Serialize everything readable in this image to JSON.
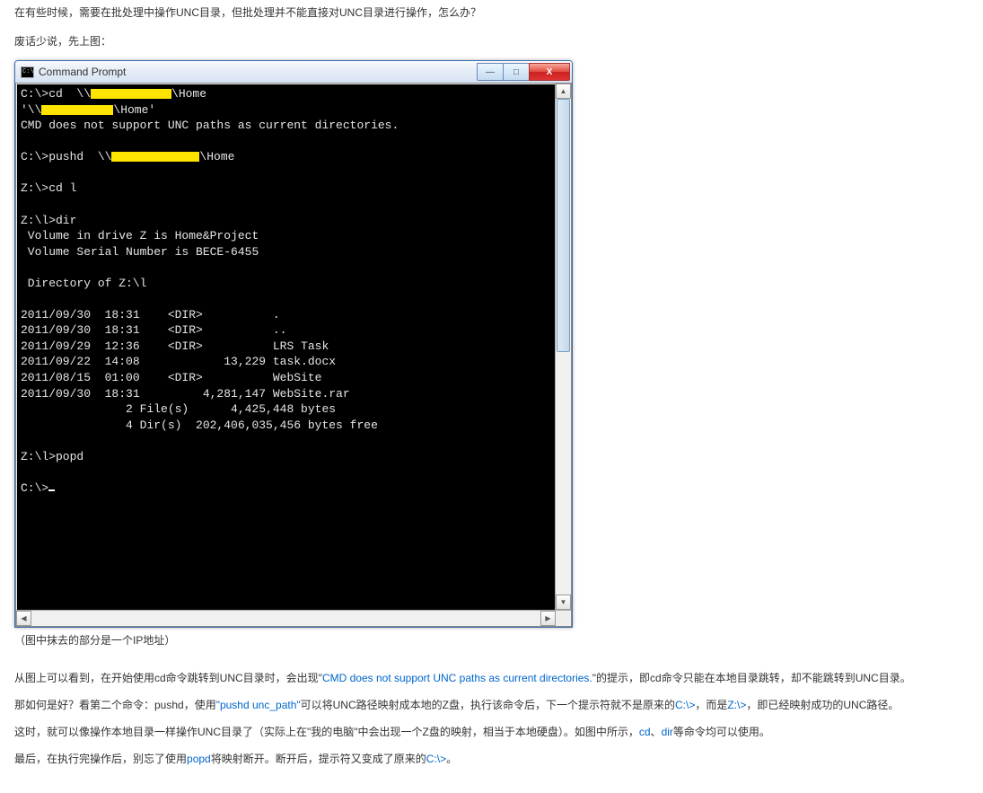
{
  "intro": {
    "p1": "在有些时候，需要在批处理中操作UNC目录，但批处理并不能直接对UNC目录进行操作，怎么办？",
    "p2": "废话少说，先上图："
  },
  "window": {
    "title": "Command Prompt",
    "icon_text": "C:\\",
    "buttons": {
      "min": "—",
      "max": "□",
      "close": "X"
    }
  },
  "terminal": {
    "l1a": "C:\\>cd  \\\\",
    "l1b": "\\Home",
    "l2a": "'\\\\",
    "l2b": "\\Home'",
    "l3": "CMD does not support UNC paths as current directories.",
    "blank": "",
    "l4a": "C:\\>pushd  \\\\",
    "l4b": "\\Home",
    "l5": "Z:\\>cd l",
    "l6": "Z:\\l>dir",
    "l7": " Volume in drive Z is Home&Project",
    "l8": " Volume Serial Number is BECE-6455",
    "l9": " Directory of Z:\\l",
    "l10": "2011/09/30  18:31    <DIR>          .",
    "l11": "2011/09/30  18:31    <DIR>          ..",
    "l12": "2011/09/29  12:36    <DIR>          LRS Task",
    "l13": "2011/09/22  14:08            13,229 task.docx",
    "l14": "2011/08/15  01:00    <DIR>          WebSite",
    "l15": "2011/09/30  18:31         4,281,147 WebSite.rar",
    "l16": "               2 File(s)      4,425,448 bytes",
    "l17": "               4 Dir(s)  202,406,035,456 bytes free",
    "l18": "Z:\\l>popd",
    "l19": "C:\\>"
  },
  "caption": "（图中抹去的部分是一个IP地址）",
  "body": {
    "p1a": "从图上可以看到，在开始使用cd命令跳转到UNC目录时，会出现",
    "p1b_q1": "\"",
    "p1b_link": "CMD does not support UNC paths as current directories.",
    "p1b_q2": "\"",
    "p1c": "的提示，即cd命令只能在本地目录跳转，却不能跳转到UNC目录。",
    "p2a": "那如何是好？看第二个命令：pushd，使用",
    "p2b_link": "\"pushd unc_path\"",
    "p2c": "可以将UNC路径映射成本地的Z盘，执行该命令后，下一个提示符就不是原来的",
    "p2d_link": "C:\\>",
    "p2e": "，而是",
    "p2f_link": "Z:\\>",
    "p2g": "，即已经映射成功的UNC路径。",
    "p3a": "这时，就可以像操作本地目录一样操作UNC目录了（实际上在\"我的电脑\"中会出现一个Z盘的映射，相当于本地硬盘）。如图中所示，",
    "p3b_link": "cd",
    "p3c": "、",
    "p3d_link": "dir",
    "p3e": "等命令均可以使用。",
    "p4a": "最后，在执行完操作后，别忘了使用",
    "p4b_link": "popd",
    "p4c": "将映射断开。断开后，提示符又变成了原来的",
    "p4d_link": "C:\\>",
    "p4e": "。"
  }
}
